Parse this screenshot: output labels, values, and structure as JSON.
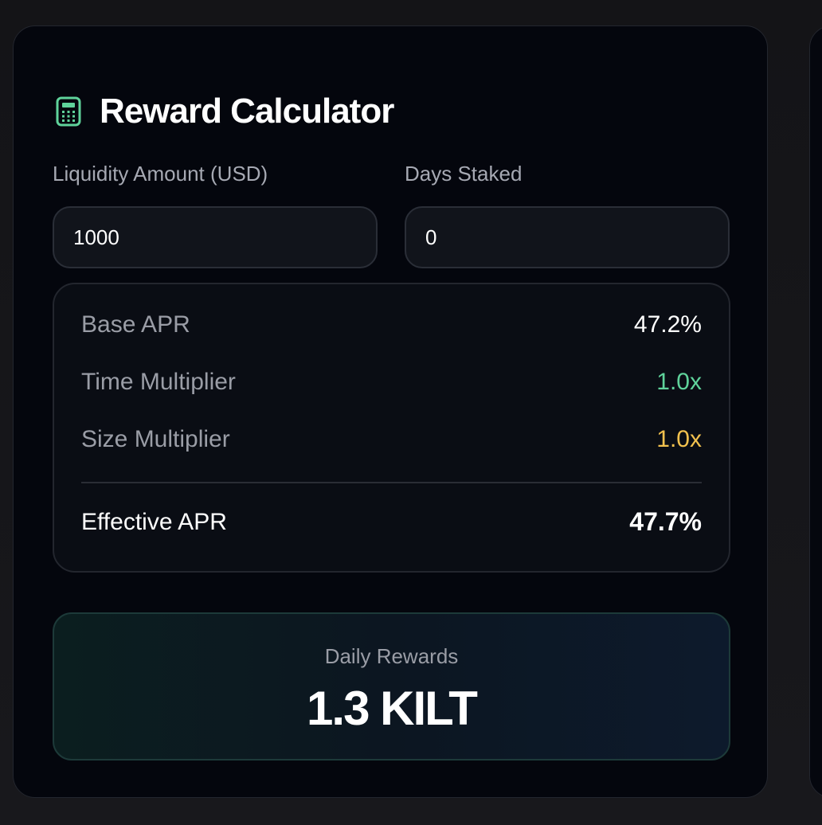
{
  "calculator": {
    "title": "Reward Calculator",
    "icon": "calculator-icon",
    "accent_color": "#5fd39b"
  },
  "inputs": {
    "liquidity_label": "Liquidity Amount (USD)",
    "liquidity_value": "1000",
    "days_label": "Days Staked",
    "days_value": "0"
  },
  "apr": {
    "rows": [
      {
        "label": "Base APR",
        "value": "47.2%",
        "color": "#ffffff"
      },
      {
        "label": "Time Multiplier",
        "value": "1.0x",
        "color": "#5fd39b"
      },
      {
        "label": "Size Multiplier",
        "value": "1.0x",
        "color": "#f2c14e"
      }
    ],
    "effective_label": "Effective APR",
    "effective_value": "47.7%"
  },
  "rewards": {
    "label": "Daily Rewards",
    "value": "1.3 KILT"
  }
}
